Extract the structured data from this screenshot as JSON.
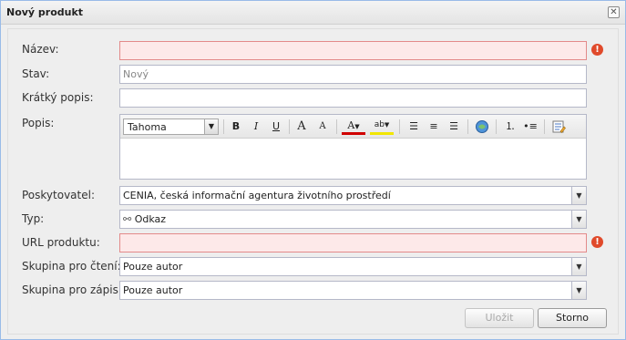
{
  "window": {
    "title": "Nový produkt"
  },
  "form": {
    "name": {
      "label": "Název:",
      "value": ""
    },
    "status": {
      "label": "Stav:",
      "placeholder": "Nový"
    },
    "short_desc": {
      "label": "Krátký popis:",
      "value": ""
    },
    "desc": {
      "label": "Popis:",
      "font": "Tahoma",
      "toolbar": {
        "bold": "B",
        "italic": "I",
        "underline": "U",
        "grow": "A",
        "shrink": "A",
        "color": "A",
        "highlight": "ab"
      }
    },
    "provider": {
      "label": "Poskytovatel:",
      "value": "CENIA, česká informační agentura životního prostředí"
    },
    "type": {
      "label": "Typ:",
      "value": "Odkaz"
    },
    "url": {
      "label": "URL produktu:",
      "value": ""
    },
    "read_group": {
      "label": "Skupina pro čtení:",
      "value": "Pouze autor"
    },
    "write_group": {
      "label": "Skupina pro zápis:",
      "value": "Pouze autor"
    }
  },
  "buttons": {
    "save": "Uložit",
    "cancel": "Storno"
  },
  "colors": {
    "invalid_bg": "#fde9e9",
    "invalid_border": "#e38a8a",
    "error_icon": "#e04a2b"
  },
  "icons": [
    "close-icon",
    "error-icon",
    "link-icon",
    "chevron-down-icon"
  ]
}
